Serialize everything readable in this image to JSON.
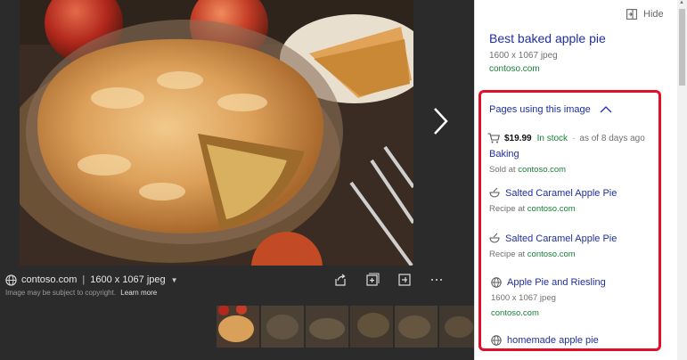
{
  "viewer": {
    "source_domain": "contoso.com",
    "separator": "|",
    "dimensions": "1600 x 1067 jpeg",
    "copyright_text": "Image may be subject to copyright.",
    "learn_more": "Learn more"
  },
  "panel": {
    "hide_label": "Hide",
    "title": "Best baked apple pie",
    "dimensions": "1600 x 1067 jpeg",
    "source": "contoso.com",
    "pages_heading": "Pages using this image",
    "shopping": {
      "price": "$19.99",
      "stock": "In stock",
      "dot": "·",
      "as_of": "as of 8 days ago",
      "name": "Baking",
      "sold_prefix": "Sold at ",
      "sold_domain": "contoso.com"
    },
    "recipes": [
      {
        "name": "Salted Caramel Apple Pie",
        "prefix": "Recipe at ",
        "domain": "contoso.com"
      },
      {
        "name": "Salted Caramel Apple Pie",
        "prefix": "Recipe at ",
        "domain": "contoso.com"
      }
    ],
    "pages": [
      {
        "name": "Apple Pie and Riesling",
        "dims": "1600 x 1067 jpeg",
        "domain": "contoso.com"
      },
      {
        "name": "homemade apple pie"
      }
    ]
  },
  "colors": {
    "link": "#1f2fa0",
    "green": "#188038",
    "highlight": "#e0102a",
    "viewer_bg": "#2b2b2b"
  },
  "icons": [
    "globe-icon",
    "share-icon",
    "add-collection-icon",
    "expand-icon",
    "more-icon",
    "hide-icon",
    "chevron-up-icon",
    "cart-icon",
    "recipe-icon",
    "next-arrow-icon"
  ]
}
